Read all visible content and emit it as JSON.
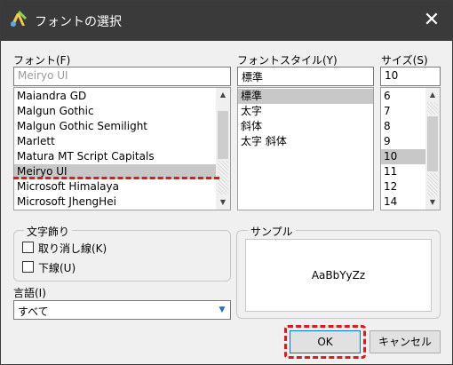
{
  "window": {
    "title": "フォントの選択",
    "close_glyph": "✕"
  },
  "font": {
    "label": "フォント(F)",
    "value": "Meiryo UI",
    "items": [
      "Maiandra GD",
      "Malgun Gothic",
      "Malgun Gothic Semilight",
      "Marlett",
      "Matura MT Script Capitals",
      "Meiryo UI",
      "Microsoft Himalaya",
      "Microsoft JhengHei"
    ],
    "selected_index": 5
  },
  "style": {
    "label": "フォントスタイル(Y)",
    "value": "標準",
    "items": [
      "標準",
      "太字",
      "斜体",
      "太字 斜体"
    ],
    "selected_index": 0
  },
  "size": {
    "label": "サイズ(S)",
    "value": "10",
    "items": [
      "6",
      "7",
      "8",
      "9",
      "10",
      "11",
      "12",
      "14"
    ],
    "selected_index": 4
  },
  "effects": {
    "label": "文字飾り",
    "strikeout": "取り消し線(K)",
    "underline": "下線(U)"
  },
  "sample": {
    "label": "サンプル",
    "text": "AaBbYyZz"
  },
  "script": {
    "label": "言語(I)",
    "value": "すべて"
  },
  "buttons": {
    "ok": "OK",
    "cancel": "キャンセル"
  },
  "colors": {
    "titlebar": "#3a3a3a",
    "selection": "#c8c8c8",
    "highlight": "#e01a1a"
  }
}
